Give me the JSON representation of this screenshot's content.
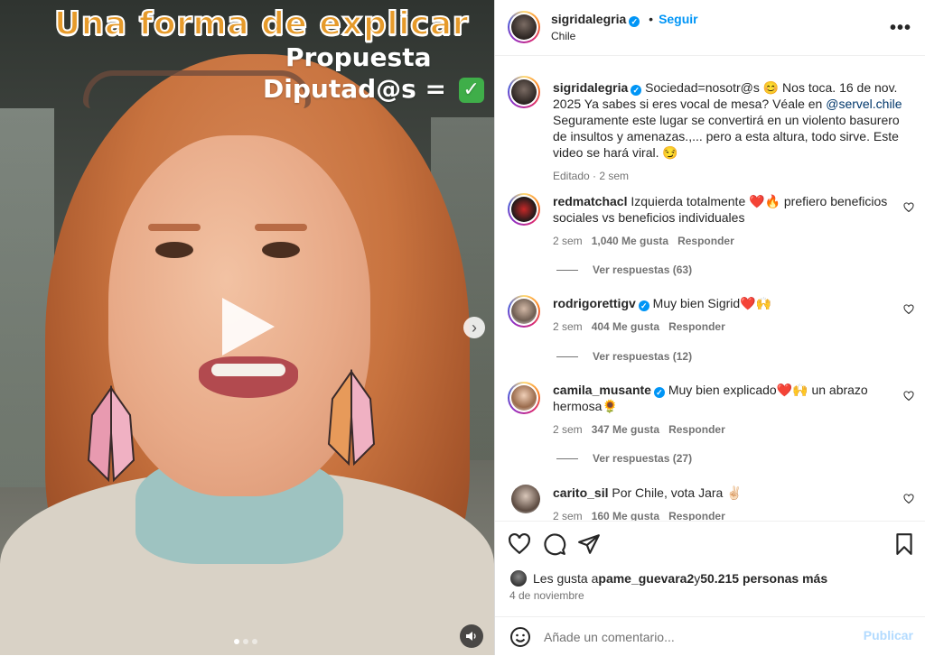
{
  "media": {
    "overlay_line1": "Una forma de explicar",
    "overlay_line2": "Propuesta",
    "overlay_line3": "Diputad@s =",
    "overlay_check": "✓",
    "slide_count": 3,
    "active_slide": 1
  },
  "header": {
    "username": "sigridalegria",
    "dot": "•",
    "follow": "Seguir",
    "location": "Chile",
    "more": "•••"
  },
  "caption": {
    "username": "sigridalegria",
    "text_before_mention": "Sociedad=nosotr@s 😊 Nos toca. 16 de nov. 2025 Ya sabes si eres vocal de mesa? Véale en ",
    "mention": "@servel.chile",
    "text_after_mention": " Seguramente este lugar se convertirá en un violento basurero de insultos y amenazas.,... pero a esta altura, todo sirve. Este video se hará viral. 😏",
    "meta": "Editado · 2 sem"
  },
  "comments": [
    {
      "username": "redmatchacl",
      "text": "Izquierda totalmente ❤️🔥 prefiero beneficios sociales vs beneficios individuales",
      "time": "2 sem",
      "likes": "1,040 Me gusta",
      "reply": "Responder",
      "view_replies": "Ver respuestas (63)"
    },
    {
      "username": "rodrigorettigv",
      "text": "Muy bien Sigrid❤️🙌",
      "time": "2 sem",
      "likes": "404 Me gusta",
      "reply": "Responder",
      "view_replies": "Ver respuestas (12)"
    },
    {
      "username": "camila_musante",
      "text": "Muy bien explicado❤️🙌 un abrazo hermosa🌻",
      "time": "2 sem",
      "likes": "347 Me gusta",
      "reply": "Responder",
      "view_replies": "Ver respuestas (27)"
    },
    {
      "username": "carito_sil",
      "text": "Por Chile, vota Jara ✌🏻",
      "time": "2 sem",
      "likes": "160 Me gusta",
      "reply": "Responder"
    }
  ],
  "likes": {
    "prefix": "Les gusta a ",
    "user": "pame_guevara2",
    "middle": " y ",
    "others": "50.215 personas más"
  },
  "date": "4 de noviembre",
  "comment_input": {
    "placeholder": "Añade un comentario...",
    "publish": "Publicar"
  },
  "colors": {
    "accent": "#0095f6",
    "overlay_orange": "#e69a2a",
    "check_green": "#3fae49"
  }
}
